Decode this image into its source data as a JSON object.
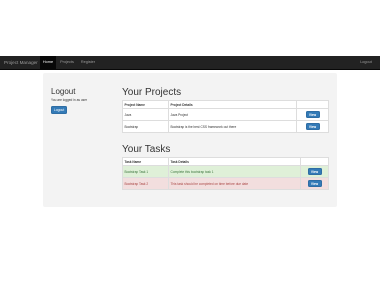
{
  "nav": {
    "brand": "Project Manager",
    "links": [
      {
        "label": "Home",
        "active": true
      },
      {
        "label": "Projects"
      },
      {
        "label": "Register"
      }
    ],
    "logout_label": "Logout"
  },
  "sidebar": {
    "title": "Logout",
    "status_text": "You are logged in as user",
    "button_label": "Logout"
  },
  "projects": {
    "title": "Your Projects",
    "columns": [
      "Project Name",
      "Project Details",
      ""
    ],
    "rows": [
      {
        "name": "Java",
        "details": "Java Project",
        "action": "View"
      },
      {
        "name": "Bootstrap",
        "details": "Bootstrap is the best CSS framework out there",
        "action": "View"
      }
    ]
  },
  "tasks": {
    "title": "Your Tasks",
    "columns": [
      "Task Name",
      "Task Details",
      ""
    ],
    "rows": [
      {
        "name": "Bootstrap Task 1",
        "details": "Complete this bootstrap task 1",
        "action": "View",
        "status": "success"
      },
      {
        "name": "Bootstrap Task 2",
        "details": "This task should be completed on time before due date",
        "action": "View",
        "status": "danger"
      }
    ]
  },
  "colors": {
    "navbar": "#222222",
    "primary": "#337ab7",
    "success_row": "#dff0d8",
    "danger_row": "#f2dede"
  }
}
